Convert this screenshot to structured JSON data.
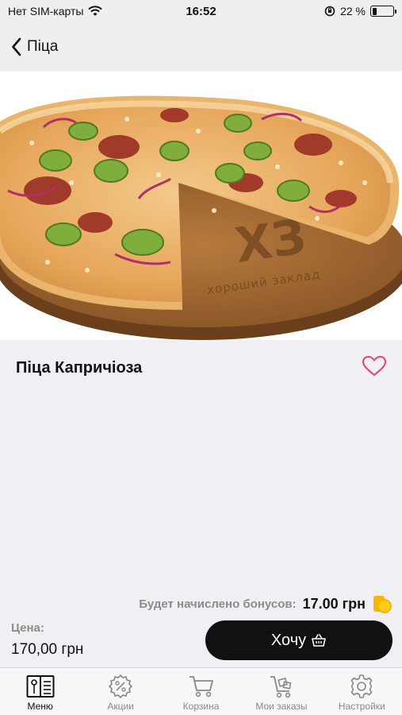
{
  "status_bar": {
    "carrier": "Нет SIM-карты",
    "time": "16:52",
    "battery_text": "22 %",
    "battery_level": 0.22
  },
  "nav": {
    "back_label": "Піца"
  },
  "hero": {
    "board_text_big": "ХЗ",
    "board_text_small": "хороший заклад"
  },
  "product": {
    "title": "Піца Капричіоза",
    "favorite": false
  },
  "bonus": {
    "label": "Будет начислено бонусов:",
    "value": "17.00 грн"
  },
  "price": {
    "label": "Цена:",
    "value": "170,00 грн"
  },
  "action": {
    "want_label": "Хочу"
  },
  "tabs": [
    {
      "label": "Меню",
      "icon": "menu-book-icon",
      "active": true
    },
    {
      "label": "Акции",
      "icon": "discount-icon",
      "active": false
    },
    {
      "label": "Корзина",
      "icon": "cart-icon",
      "active": false
    },
    {
      "label": "Мои заказы",
      "icon": "orders-cart-icon",
      "active": false
    },
    {
      "label": "Настройки",
      "icon": "gear-icon",
      "active": false
    }
  ],
  "colors": {
    "heart": "#e8446b",
    "button_bg": "#111111",
    "coin": "#f5b800"
  }
}
